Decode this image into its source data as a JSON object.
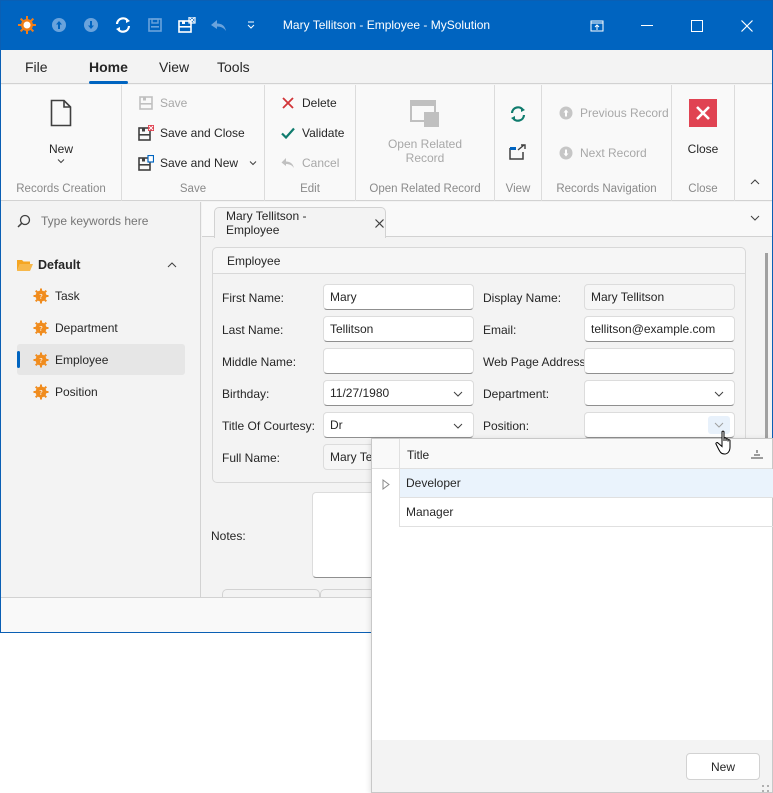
{
  "window": {
    "title": "Mary Tellitson - Employee - MySolution",
    "quick_access": [
      "app-logo-icon",
      "previous-record-icon",
      "next-record-icon",
      "refresh-icon",
      "save-icon",
      "save-and-close-icon",
      "undo-icon",
      "customize-quick-access-icon"
    ],
    "controls": [
      "restore-panel-icon",
      "minimize-icon",
      "maximize-icon",
      "close-icon"
    ]
  },
  "ribbon_tabs": [
    {
      "label": "File",
      "active": false
    },
    {
      "label": "Home",
      "active": true
    },
    {
      "label": "View",
      "active": false
    },
    {
      "label": "Tools",
      "active": false
    }
  ],
  "ribbon": {
    "records_creation": {
      "label": "Records Creation",
      "new": "New"
    },
    "save": {
      "label": "Save",
      "save": "Save",
      "save_and_close": "Save and Close",
      "save_and_new": "Save and New"
    },
    "edit": {
      "label": "Edit",
      "delete": "Delete",
      "validate": "Validate",
      "cancel": "Cancel"
    },
    "open_related": {
      "label": "Open Related Record",
      "button": "Open Related Record"
    },
    "view": {
      "label": "View"
    },
    "navigation": {
      "label": "Records Navigation",
      "previous": "Previous Record",
      "next": "Next Record"
    },
    "close": {
      "label": "Close",
      "button": "Close"
    },
    "colors": {
      "delete": "#d13438",
      "validate": "#107c6e",
      "close_bg": "#e04352",
      "refresh": "#107c6e"
    }
  },
  "nav": {
    "search_placeholder": "Type keywords here",
    "group": "Default",
    "items": [
      {
        "label": "Task",
        "selected": false
      },
      {
        "label": "Department",
        "selected": false
      },
      {
        "label": "Employee",
        "selected": true
      },
      {
        "label": "Position",
        "selected": false
      }
    ]
  },
  "document": {
    "tab_label": "Mary Tellitson - Employee",
    "group_title": "Employee",
    "fields": {
      "first_name": {
        "label": "First Name:",
        "value": "Mary"
      },
      "last_name": {
        "label": "Last Name:",
        "value": "Tellitson"
      },
      "middle_name": {
        "label": "Middle Name:",
        "value": ""
      },
      "birthday": {
        "label": "Birthday:",
        "value": "11/27/1980"
      },
      "title_of_courtesy": {
        "label": "Title Of Courtesy:",
        "value": "Dr"
      },
      "full_name": {
        "label": "Full Name:",
        "value": "Mary Tell"
      },
      "display_name": {
        "label": "Display Name:",
        "value": "Mary Tellitson"
      },
      "email": {
        "label": "Email:",
        "value": "tellitson@example.com"
      },
      "web_page": {
        "label": "Web Page Address:",
        "value": ""
      },
      "department": {
        "label": "Department:",
        "value": ""
      },
      "position": {
        "label": "Position:",
        "value": ""
      },
      "notes": {
        "label": "Notes:",
        "value": ""
      }
    }
  },
  "lookup_popup": {
    "column_header": "Title",
    "rows": [
      {
        "title": "Developer",
        "focused": true
      },
      {
        "title": "Manager",
        "focused": false
      }
    ],
    "new_button": "New"
  }
}
